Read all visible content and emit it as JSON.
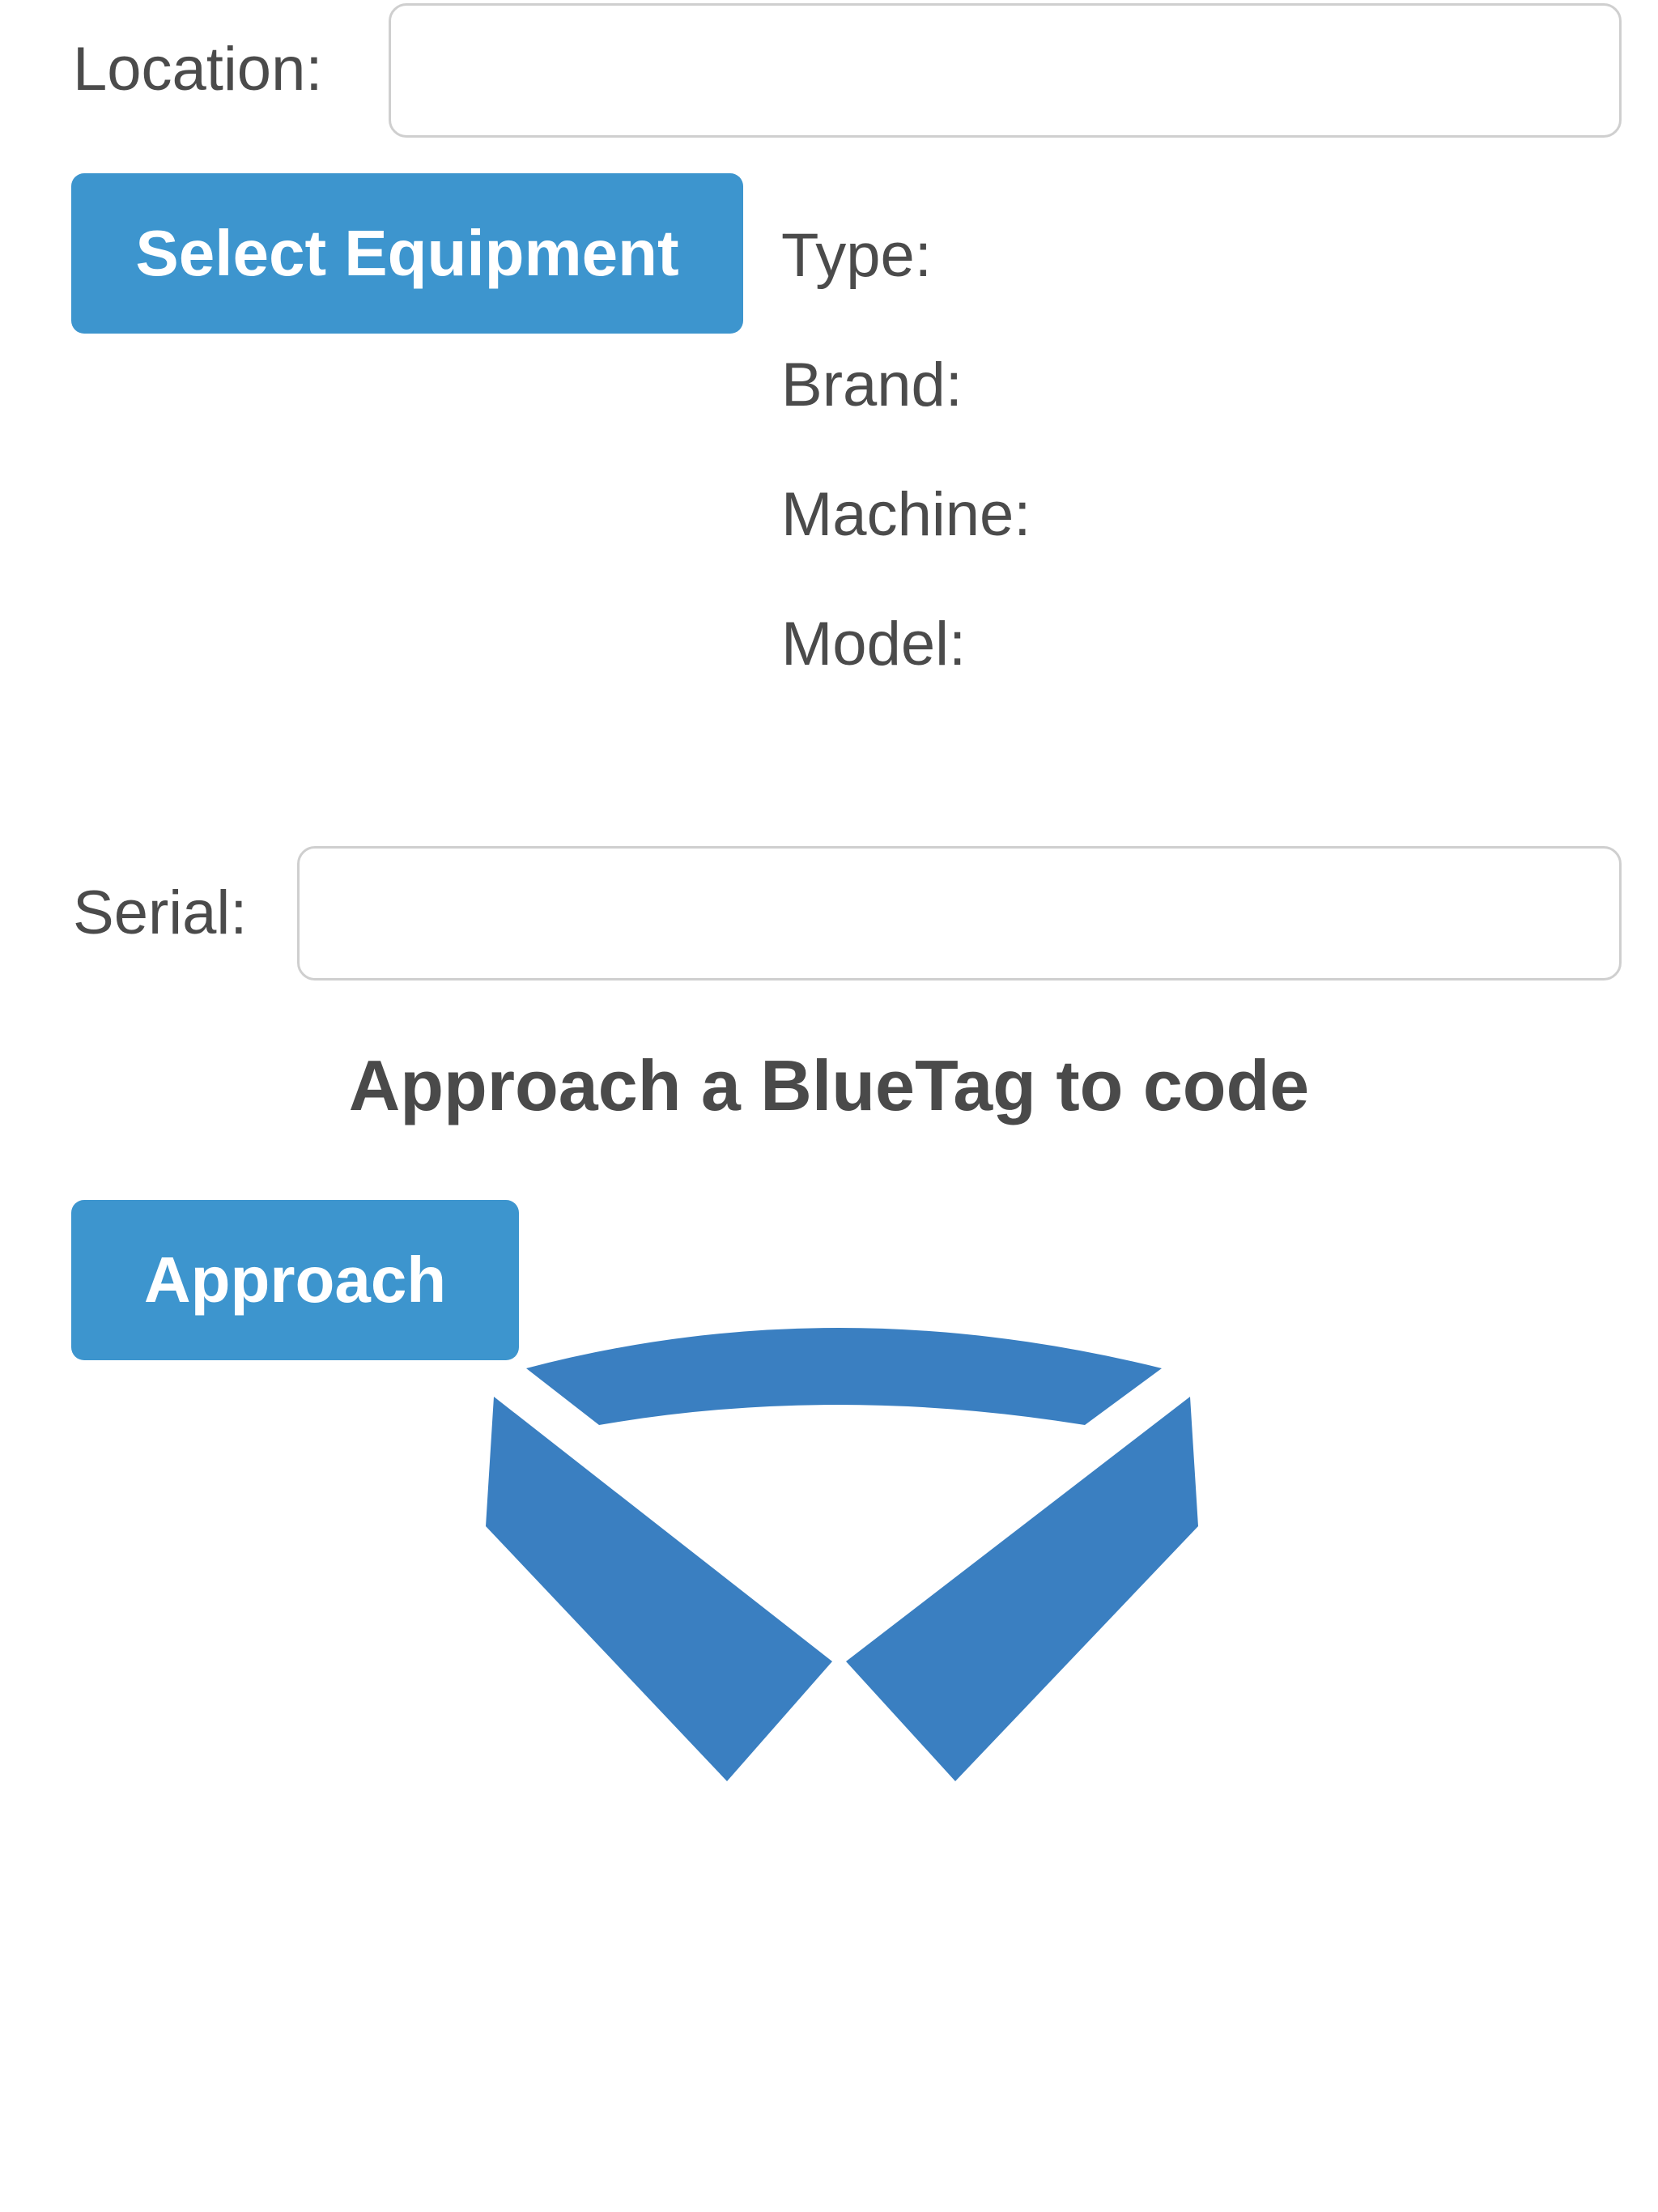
{
  "form": {
    "location_label": "Location:",
    "location_value": "",
    "select_equipment_label": "Select Equipment",
    "equipment": {
      "type_label": "Type:",
      "brand_label": "Brand:",
      "machine_label": "Machine:",
      "model_label": "Model:"
    },
    "serial_label": "Serial:",
    "serial_value": ""
  },
  "bluetag": {
    "instruction": "Approach a BlueTag to code",
    "approach_label": "Approach"
  },
  "colors": {
    "button": "#3d95ce",
    "logo": "#3a7fc1"
  },
  "icons": {
    "logo": "bluetag-collar-logo"
  }
}
